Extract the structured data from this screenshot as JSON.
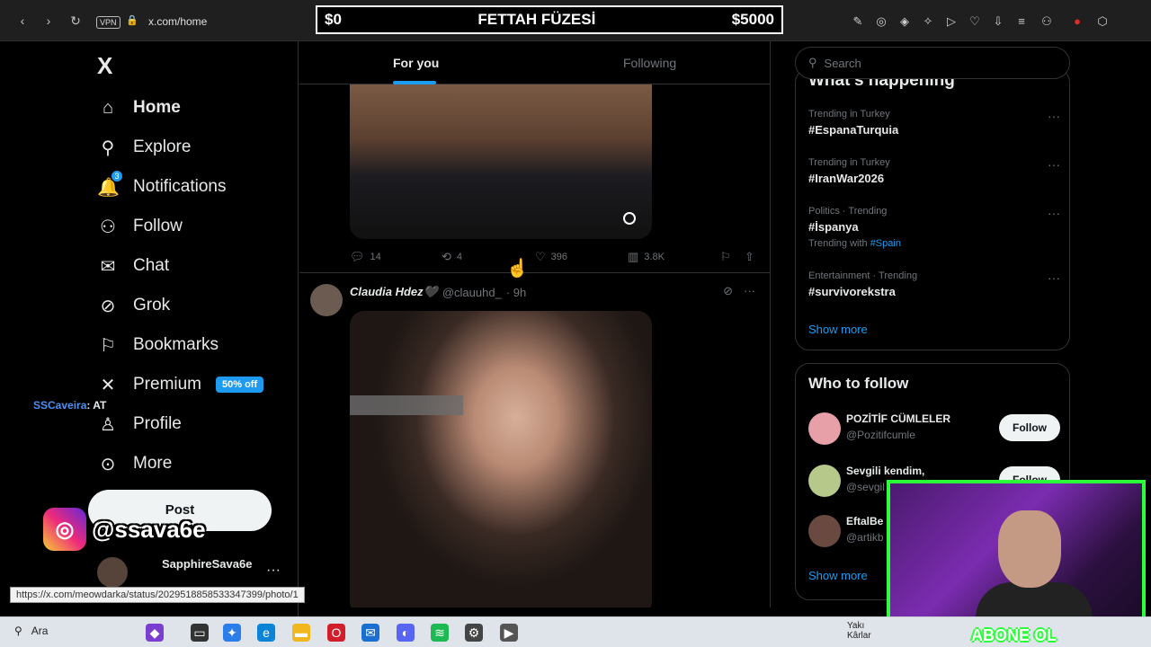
{
  "browser": {
    "url": "x.com/home",
    "vpn_label": "VPN",
    "nav_icons": [
      "back-icon",
      "forward-icon",
      "reload-icon"
    ]
  },
  "banner": {
    "left": "$0",
    "title": "FETTAH FÜZESİ",
    "right": "$5000"
  },
  "sidebar": {
    "logo": "X",
    "items": [
      {
        "label": "Home",
        "icon": "home-icon"
      },
      {
        "label": "Explore",
        "icon": "search-icon"
      },
      {
        "label": "Notifications",
        "icon": "bell-icon",
        "badge": "3"
      },
      {
        "label": "Follow",
        "icon": "person-plus-icon"
      },
      {
        "label": "Chat",
        "icon": "mail-icon"
      },
      {
        "label": "Grok",
        "icon": "grok-icon"
      },
      {
        "label": "Bookmarks",
        "icon": "bookmark-icon"
      },
      {
        "label": "Premium",
        "icon": "x-icon",
        "badge": "50% off"
      },
      {
        "label": "Profile",
        "icon": "person-icon"
      },
      {
        "label": "More",
        "icon": "more-circle-icon"
      }
    ],
    "post_label": "Post",
    "account_name": "SapphireSava6e"
  },
  "overlay": {
    "chat_user": "SSCaveira",
    "chat_text": ": AT",
    "instagram_handle": "@ssava6e",
    "link_preview": "https://x.com/meowdarka/status/2029518858533347399/photo/1",
    "subscribe_text": "ABONE OL"
  },
  "feed": {
    "tabs": [
      "For you",
      "Following"
    ],
    "tweet1": {
      "replies": "14",
      "reposts": "4",
      "likes": "396",
      "views": "3.8K"
    },
    "tweet2": {
      "name": "Claudia Hdez🖤",
      "handle": "@clauuhd_",
      "time": "· 9h"
    }
  },
  "right": {
    "search_placeholder": "Search",
    "trends_title": "What's happening",
    "trends": [
      {
        "context": "Trending in Turkey",
        "title": "#EspanaTurquia"
      },
      {
        "context": "Trending in Turkey",
        "title": "#IranWar2026"
      },
      {
        "context": "Politics · Trending",
        "title": "#İspanya",
        "with_label": "Trending with",
        "with_tag": "#Spain"
      },
      {
        "context": "Entertainment · Trending",
        "title": "#survivorekstra"
      }
    ],
    "show_more": "Show more",
    "wtf_title": "Who to follow",
    "follows": [
      {
        "name": "POZİTİF CÜMLELER",
        "handle": "@Pozitifcumle"
      },
      {
        "name": "Sevgili kendim,",
        "handle": "@sevgil"
      },
      {
        "name": "EftalBe",
        "handle": "@artikb"
      }
    ],
    "follow_label": "Follow"
  },
  "taskbar": {
    "search_label": "Ara",
    "weather_line1": "Yakı",
    "weather_line2": "Kârlar"
  },
  "colors": {
    "accent": "#1d9bf0",
    "background": "#000000",
    "webcam_border": "#2aff3a"
  }
}
